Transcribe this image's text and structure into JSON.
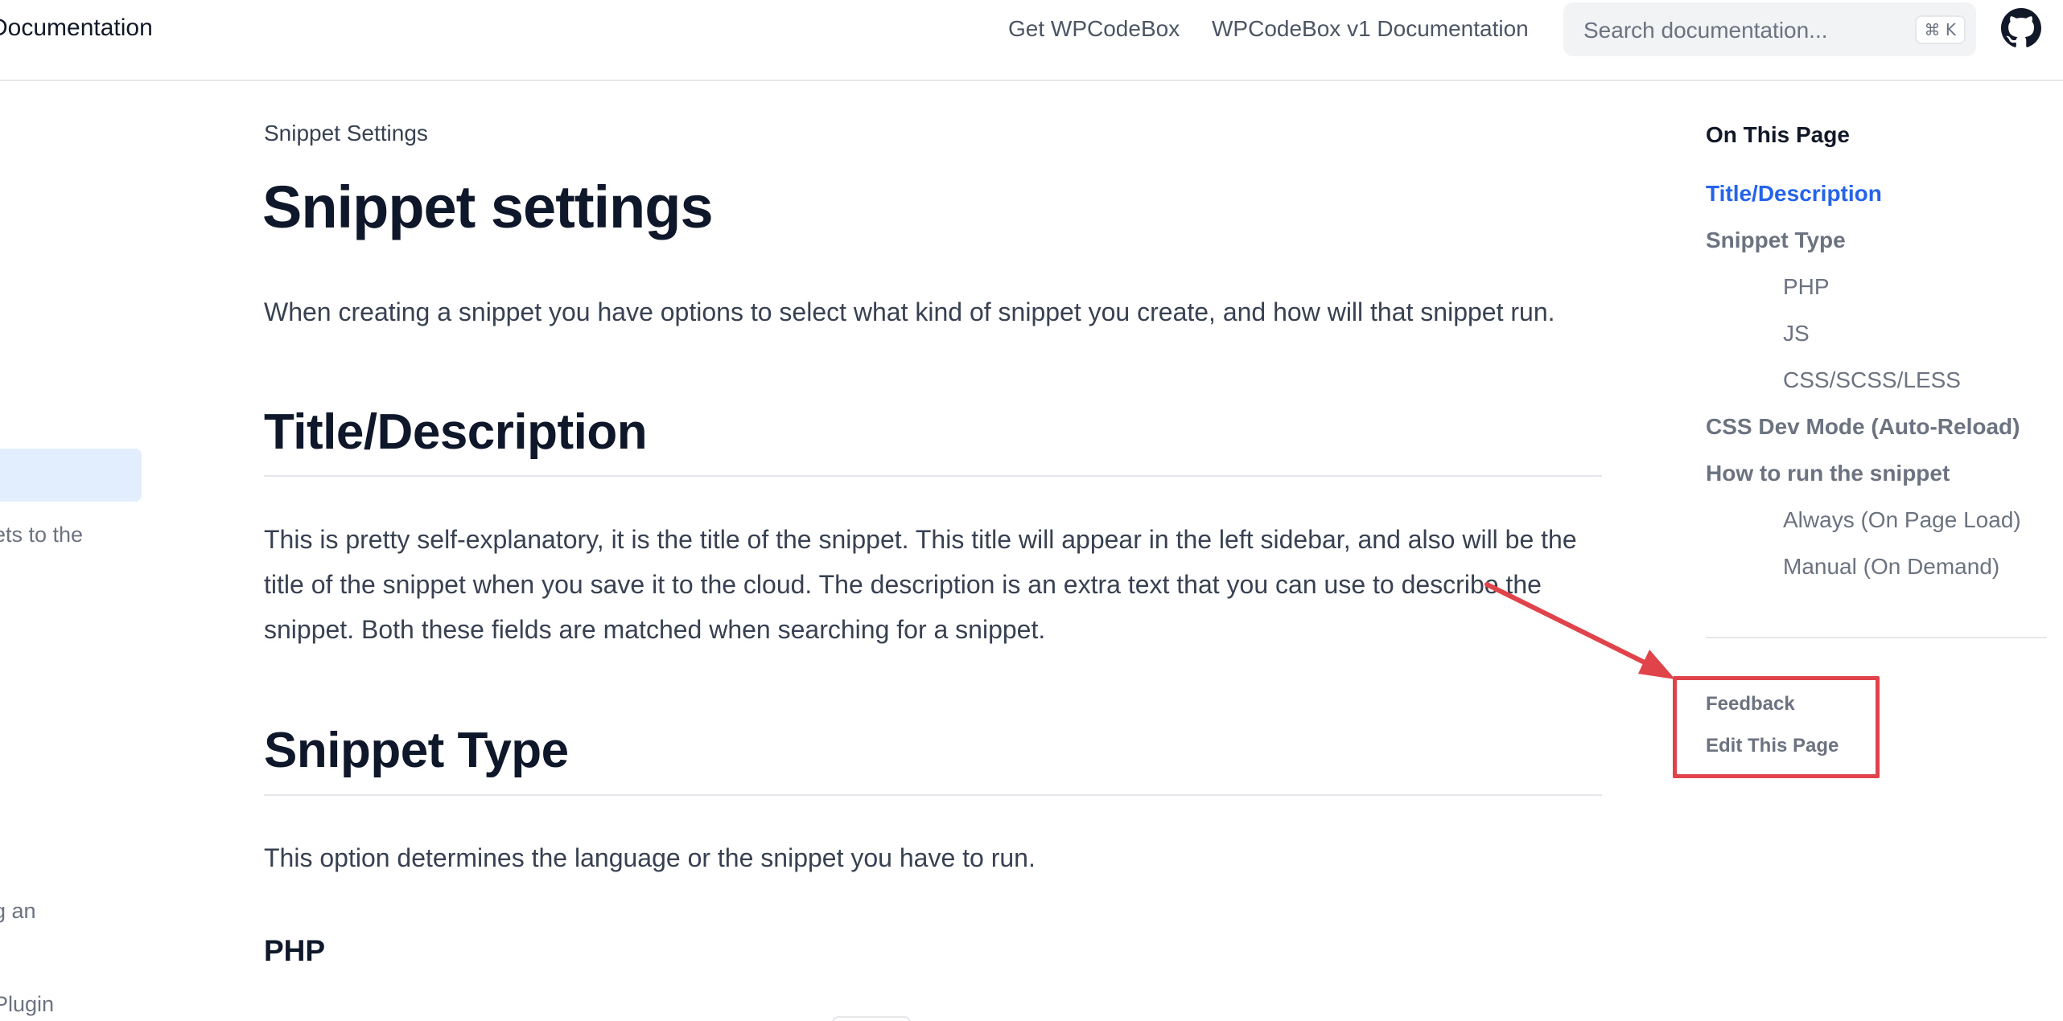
{
  "header": {
    "site_title": "Documentation",
    "nav": {
      "get_wpcodebox": "Get WPCodeBox",
      "v1_docs": "WPCodeBox v1 Documentation"
    },
    "search": {
      "placeholder": "Search documentation...",
      "shortcut": "⌘ K"
    },
    "github_icon": "github-icon"
  },
  "sidebar": {
    "visible_fragments": [
      "ets to the",
      "g an",
      "Plugin"
    ]
  },
  "main": {
    "eyebrow": "Snippet Settings",
    "title": "Snippet settings",
    "intro": "When creating a snippet you have options to select what kind of snippet you create, and how will that snippet run.",
    "sections": [
      {
        "heading": "Title/Description",
        "body": "This is pretty self-explanatory, it is the title of the snippet. This title will appear in the left sidebar, and also will be the title of the snippet when you save it to the cloud. The description is an extra text that you can use to describe the snippet. Both these fields are matched when searching for a snippet."
      },
      {
        "heading": "Snippet Type",
        "body": "This option determines the language or the snippet you have to run."
      }
    ],
    "subheading": "PHP"
  },
  "toc": {
    "heading": "On This Page",
    "items": [
      {
        "label": "Title/Description",
        "level": 1,
        "active": true
      },
      {
        "label": "Snippet Type",
        "level": 1,
        "active": false
      },
      {
        "label": "PHP",
        "level": 2,
        "active": false
      },
      {
        "label": "JS",
        "level": 2,
        "active": false
      },
      {
        "label": "CSS/SCSS/LESS",
        "level": 2,
        "active": false
      },
      {
        "label": "CSS Dev Mode (Auto-Reload)",
        "level": 1,
        "active": false
      },
      {
        "label": "How to run the snippet",
        "level": 1,
        "active": false
      },
      {
        "label": "Always (On Page Load)",
        "level": 2,
        "active": false
      },
      {
        "label": "Manual (On Demand)",
        "level": 2,
        "active": false
      }
    ],
    "meta_links": {
      "feedback": "Feedback",
      "edit_page": "Edit This Page"
    }
  },
  "colors": {
    "accent": "#2563eb",
    "annotation": "#e0434a",
    "sidebar_active": "#e2edfd"
  }
}
